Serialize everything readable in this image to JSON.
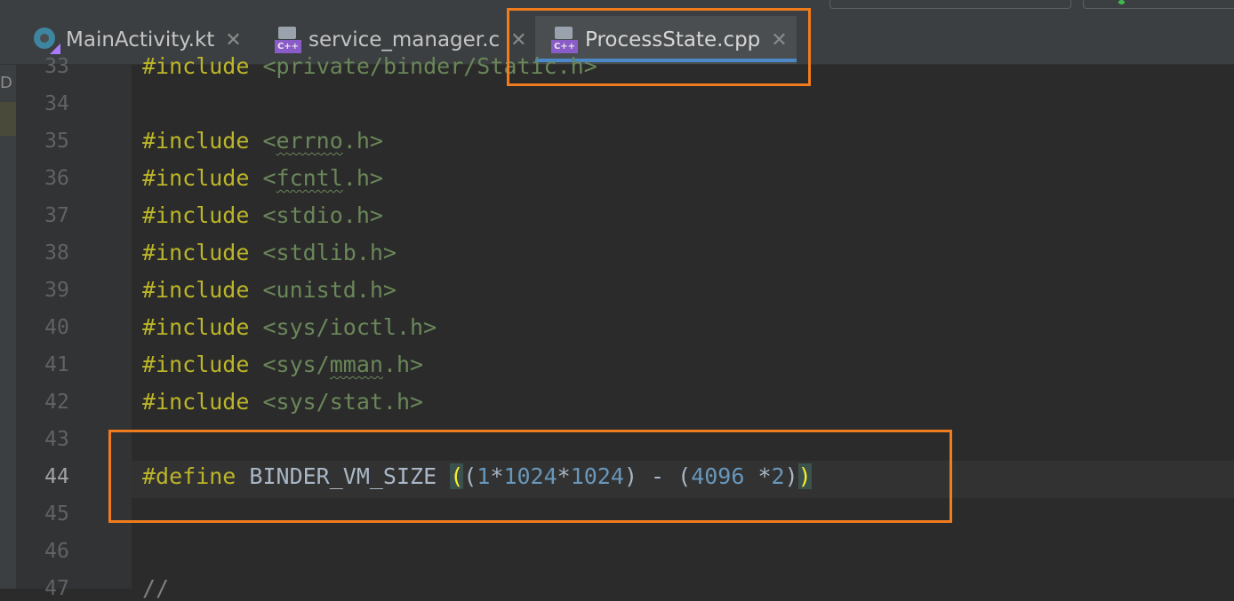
{
  "tabs": [
    {
      "label": "MainActivity.kt",
      "icon": "kotlin-file-icon",
      "active": false
    },
    {
      "label": "service_manager.c",
      "icon": "cpp-file-icon",
      "active": false
    },
    {
      "label": "ProcessState.cpp",
      "icon": "cpp-file-icon",
      "active": true
    }
  ],
  "close_glyph": "✕",
  "cpp_badge": "C++",
  "gutter_letter": "D",
  "line_numbers": [
    "33",
    "34",
    "35",
    "36",
    "37",
    "38",
    "39",
    "40",
    "41",
    "42",
    "43",
    "44",
    "45",
    "46",
    "47"
  ],
  "current_line": "44",
  "code": {
    "l33": {
      "kw": "#include",
      "sp": " ",
      "hdr": "<private/binder/Static.h>"
    },
    "l35": {
      "kw": "#include",
      "lt": " <",
      "name": "errno",
      "rest": ".h>"
    },
    "l36": {
      "kw": "#include",
      "lt": " <",
      "name": "fcntl",
      "rest": ".h>"
    },
    "l37": {
      "kw": "#include",
      "hdr": " <stdio.h>"
    },
    "l38": {
      "kw": "#include",
      "hdr": " <stdlib.h>"
    },
    "l39": {
      "kw": "#include",
      "hdr": " <unistd.h>"
    },
    "l40": {
      "kw": "#include",
      "hdr": " <sys/ioctl.h>"
    },
    "l41": {
      "kw": "#include",
      "lt": " <sys/",
      "name": "mman",
      "rest": ".h>"
    },
    "l42": {
      "kw": "#include",
      "hdr": " <sys/stat.h>"
    },
    "l44": {
      "kw": "#define",
      "macro": " BINDER_VM_SIZE ",
      "open_outer": "(",
      "open_inner": "(",
      "n1": "1",
      "op1": "*",
      "n2": "1024",
      "op2": "*",
      "n3": "1024",
      "mid": ") - (",
      "n4": "4096",
      "op3": " *",
      "n5": "2",
      "close_inner": ")",
      "close_outer": ")"
    },
    "l47": {
      "text": "//"
    }
  },
  "colors": {
    "highlight_box": "#f07c1d",
    "keyword": "#bbb529",
    "string": "#6a8759",
    "number": "#6897bb",
    "tab_underline": "#4a88c7"
  }
}
